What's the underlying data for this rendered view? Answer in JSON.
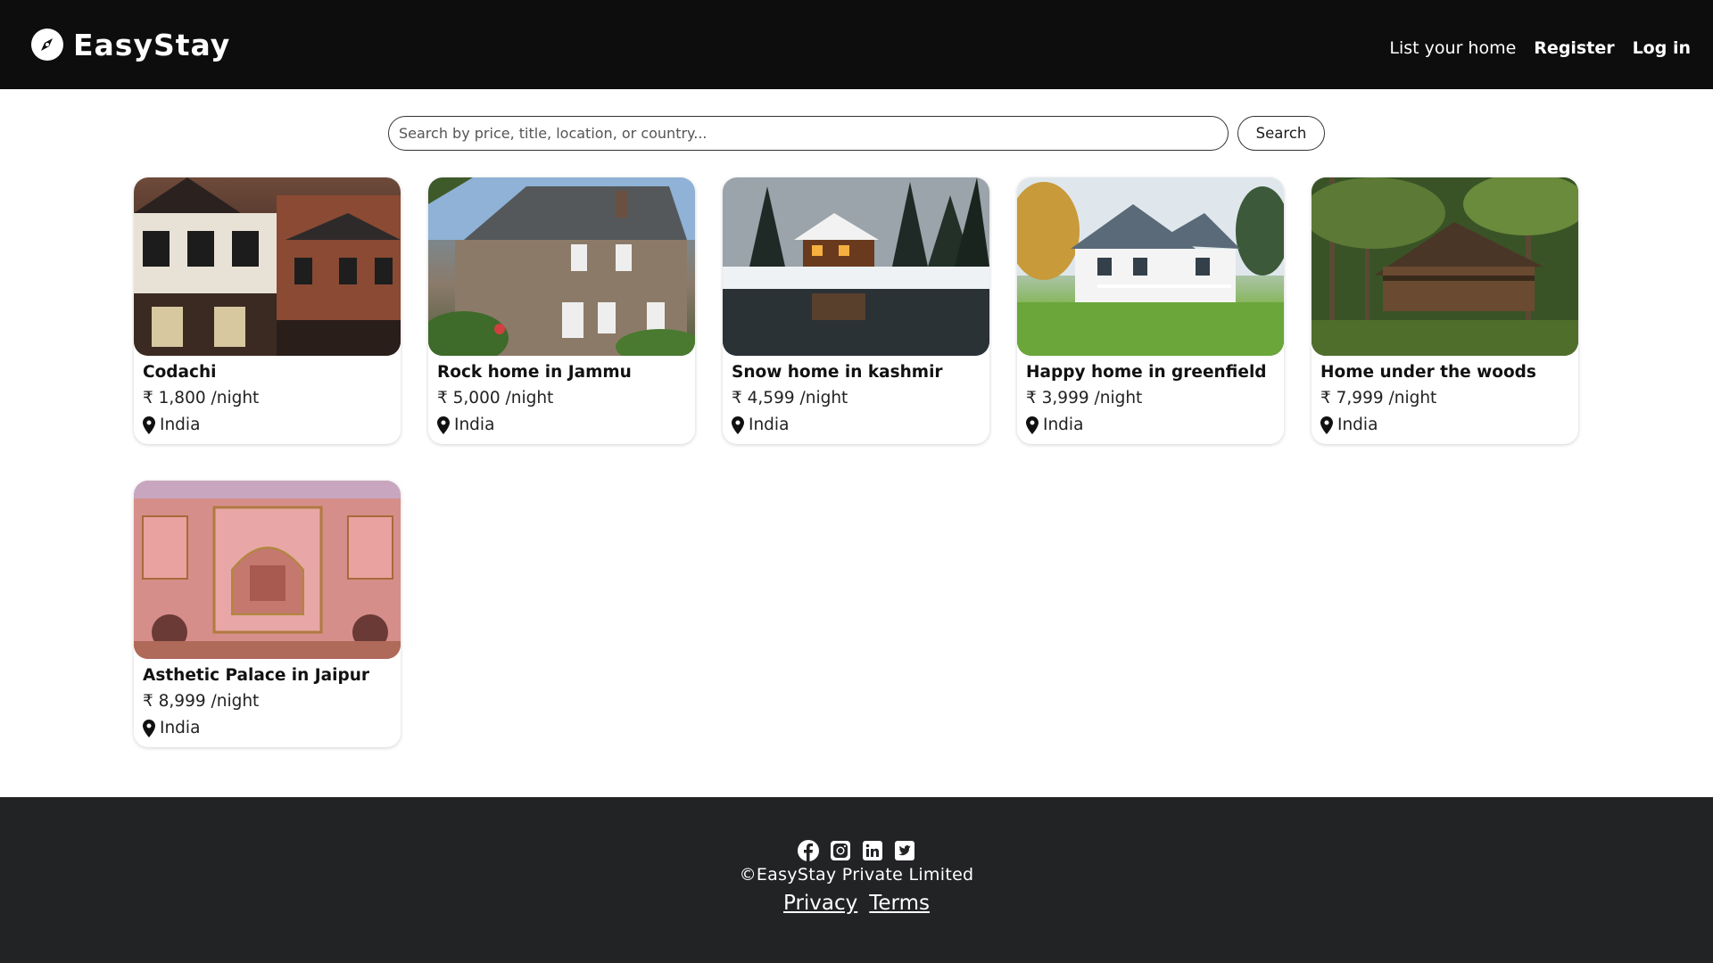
{
  "navbar": {
    "brand": "EasyStay",
    "brand_icon": "compass-icon",
    "links": {
      "list_home": "List your home",
      "register": "Register",
      "login": "Log in"
    }
  },
  "search": {
    "placeholder": "Search by price, title, location, or country...",
    "button_label": "Search"
  },
  "listings": [
    {
      "title": "Codachi",
      "price": "₹ 1,800 /night",
      "location": "India"
    },
    {
      "title": "Rock home in Jammu",
      "price": "₹ 5,000 /night",
      "location": "India"
    },
    {
      "title": "Snow home in kashmir",
      "price": "₹ 4,599 /night",
      "location": "India"
    },
    {
      "title": "Happy home in greenfield",
      "price": "₹ 3,999 /night",
      "location": "India"
    },
    {
      "title": "Home under the woods",
      "price": "₹ 7,999 /night",
      "location": "India"
    },
    {
      "title": "Asthetic Palace in Jaipur",
      "price": "₹ 8,999 /night",
      "location": "India"
    }
  ],
  "footer": {
    "social_icons": [
      "facebook-icon",
      "instagram-icon",
      "linkedin-icon",
      "twitter-icon"
    ],
    "copyright": "©EasyStay Private Limited",
    "privacy": "Privacy",
    "terms": "Terms"
  },
  "colors": {
    "navbar_bg": "#0d0d0e",
    "footer_bg": "#222325",
    "text_primary": "#111111"
  }
}
